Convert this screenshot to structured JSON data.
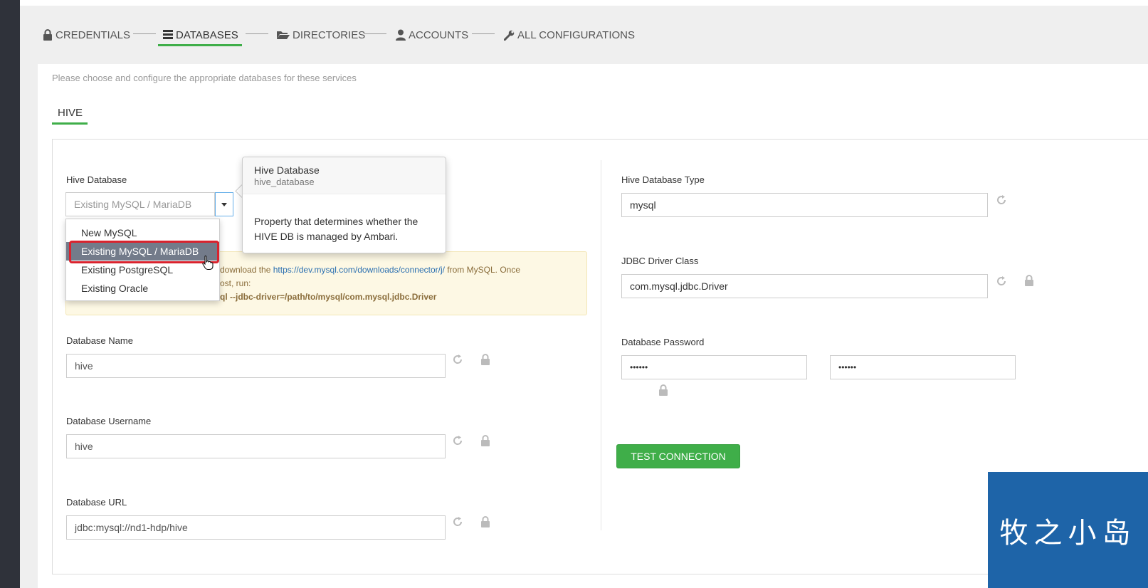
{
  "wizard": {
    "steps": [
      {
        "label": "CREDENTIALS",
        "icon": "lock-icon"
      },
      {
        "label": "DATABASES",
        "icon": "database-icon",
        "active": true
      },
      {
        "label": "DIRECTORIES",
        "icon": "folder-open-icon"
      },
      {
        "label": "ACCOUNTS",
        "icon": "user-icon"
      },
      {
        "label": "ALL CONFIGURATIONS",
        "icon": "wrench-icon"
      }
    ],
    "accent_color": "#3fae49"
  },
  "page": {
    "subtitle": "Please choose and configure the appropriate databases for these services",
    "service_tab": "HIVE"
  },
  "hive_database": {
    "label": "Hive Database",
    "selected": "Existing MySQL / MariaDB",
    "options": [
      "New MySQL",
      "Existing MySQL / MariaDB",
      "Existing PostgreSQL",
      "Existing Oracle"
    ]
  },
  "tooltip": {
    "title": "Hive Database",
    "property": "hive_database",
    "description_line1": "Property that determines whether the",
    "description_line2": "HIVE DB is managed by Ambari."
  },
  "alert": {
    "line1_text": "download the ",
    "line1_link": "https://dev.mysql.com/downloads/connector/j/",
    "line1_suffix": " from MySQL. Once",
    "line2": "ost, run:",
    "line3": "ql --jdbc-driver=/path/to/mysql/com.mysql.jdbc.Driver"
  },
  "fields": {
    "db_name": {
      "label": "Database Name",
      "value": "hive"
    },
    "db_username": {
      "label": "Database Username",
      "value": "hive"
    },
    "db_url": {
      "label": "Database URL",
      "value": "jdbc:mysql://nd1-hdp/hive"
    },
    "db_type": {
      "label": "Hive Database Type",
      "value": "mysql"
    },
    "jdbc_driver": {
      "label": "JDBC Driver Class",
      "value": "com.mysql.jdbc.Driver"
    },
    "db_password": {
      "label": "Database Password",
      "value": "••••••",
      "confirm_value": "••••••"
    }
  },
  "buttons": {
    "test_connection": "TEST CONNECTION"
  },
  "watermark": {
    "text": "牧之小岛",
    "color": "#1e64a8"
  }
}
